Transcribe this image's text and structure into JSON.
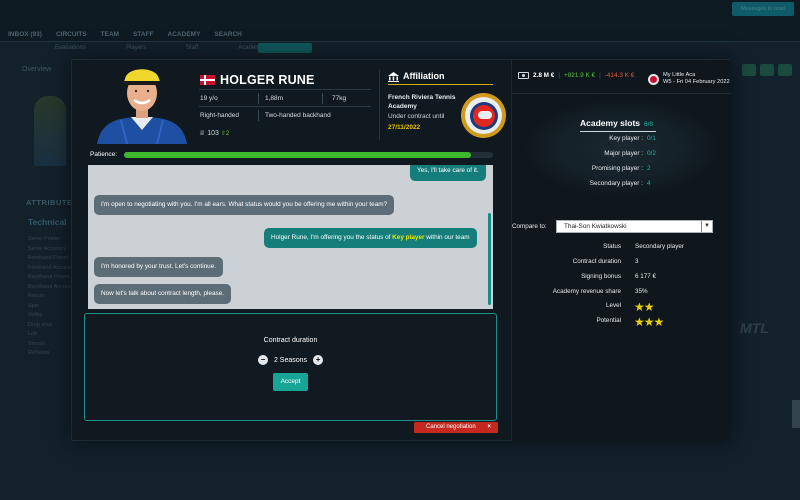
{
  "background": {
    "nav": [
      "INBOX (93)",
      "CIRCUITS",
      "TEAM",
      "STAFF",
      "ACADEMY",
      "SEARCH"
    ],
    "subnav": [
      "Evaluations",
      "Players",
      "Staff",
      "Academies"
    ],
    "overview": "Overview",
    "attributes": "ATTRIBUTES",
    "technical": "Technical",
    "attr_list": [
      "Serve Power",
      "Serve Accuracy",
      "Forehand Power",
      "Forehand Accuracy",
      "Backhand Power",
      "Backhand Accuracy",
      "Return",
      "Spin",
      "Volley",
      "Drop shot",
      "Lob",
      "Smash",
      "Reflexes"
    ],
    "messages_btn": "Messages to read",
    "logo": "MTL"
  },
  "player": {
    "name": "HOLGER RUNE",
    "age": "19 y/o",
    "height": "1,88m",
    "weight": "77kg",
    "hand": "Right-handed",
    "backhand": "Two-handed backhand",
    "rating": "103",
    "rating_delta": "2",
    "patience_label": "Patience:",
    "patience_value": 0.94
  },
  "affiliation": {
    "title": "Affiliation",
    "club": "French Riviera Tennis Academy",
    "under_contract": "Under contract until",
    "until": "27/11/2022"
  },
  "chat": [
    {
      "from": "player",
      "text": "Yes, I'll take care of it."
    },
    {
      "from": "player",
      "text": "I'm open to negotiating with you. I'm all ears. What status would you be offering me within your team?"
    },
    {
      "from": "me",
      "pre": "Holger Rune, I'm offering you the status of ",
      "keyword": "Key player",
      "post": " within our team"
    },
    {
      "from": "player",
      "text": "I'm honored by your trust. Let's continue."
    },
    {
      "from": "player",
      "text": "Now let's talk about contract length, please."
    }
  ],
  "contract": {
    "title": "Contract duration",
    "value": "2 Seasons",
    "minus": "−",
    "plus": "+",
    "accept": "Accept"
  },
  "cancel": {
    "label": "Cancel negotiation",
    "x": "×"
  },
  "finances": {
    "balance": "2.8 M €",
    "income": "+821.9 K €",
    "expense": "-414.3 K €"
  },
  "club": {
    "name": "My Little Aca",
    "week": "W5 - Fri 04 February 2022"
  },
  "slots": {
    "title": "Academy slots",
    "count": "6/8",
    "rows": [
      {
        "label": "Key player :",
        "value": "0/1"
      },
      {
        "label": "Major player :",
        "value": "0/2"
      },
      {
        "label": "Promising player :",
        "value": "2"
      },
      {
        "label": "Secondary player :",
        "value": "4"
      }
    ]
  },
  "compare": {
    "label": "Compare to:",
    "selected": "Thai-Son Kwiatkowski",
    "arrow": "▼",
    "rows": [
      {
        "label": "Status",
        "value": "Secondary player"
      },
      {
        "label": "Contract duration",
        "value": "3"
      },
      {
        "label": "Signing bonus",
        "value": "6 177 €"
      },
      {
        "label": "Academy revenue share",
        "value": "35%"
      }
    ],
    "level_label": "Level",
    "level_stars": 2,
    "potential_label": "Potential",
    "potential_stars": 3
  }
}
